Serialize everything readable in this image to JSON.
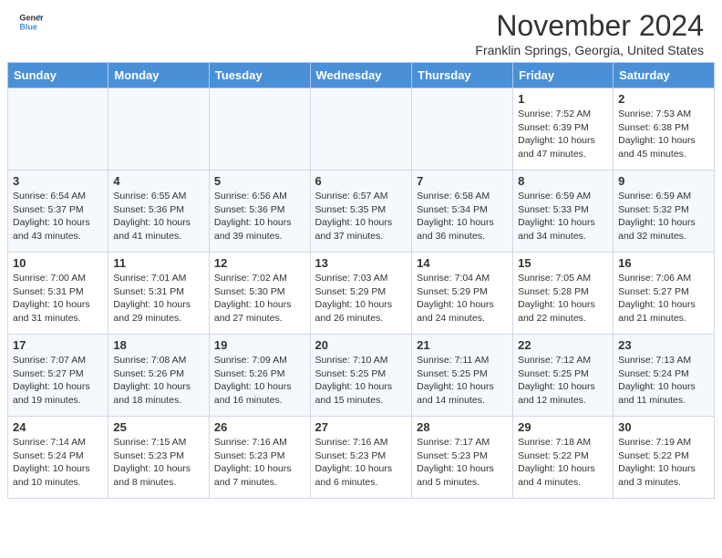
{
  "header": {
    "logo_line1": "General",
    "logo_line2": "Blue",
    "main_title": "November 2024",
    "subtitle": "Franklin Springs, Georgia, United States"
  },
  "calendar": {
    "days_of_week": [
      "Sunday",
      "Monday",
      "Tuesday",
      "Wednesday",
      "Thursday",
      "Friday",
      "Saturday"
    ],
    "weeks": [
      [
        {
          "day": "",
          "info": ""
        },
        {
          "day": "",
          "info": ""
        },
        {
          "day": "",
          "info": ""
        },
        {
          "day": "",
          "info": ""
        },
        {
          "day": "",
          "info": ""
        },
        {
          "day": "1",
          "info": "Sunrise: 7:52 AM\nSunset: 6:39 PM\nDaylight: 10 hours and 47 minutes."
        },
        {
          "day": "2",
          "info": "Sunrise: 7:53 AM\nSunset: 6:38 PM\nDaylight: 10 hours and 45 minutes."
        }
      ],
      [
        {
          "day": "3",
          "info": "Sunrise: 6:54 AM\nSunset: 5:37 PM\nDaylight: 10 hours and 43 minutes."
        },
        {
          "day": "4",
          "info": "Sunrise: 6:55 AM\nSunset: 5:36 PM\nDaylight: 10 hours and 41 minutes."
        },
        {
          "day": "5",
          "info": "Sunrise: 6:56 AM\nSunset: 5:36 PM\nDaylight: 10 hours and 39 minutes."
        },
        {
          "day": "6",
          "info": "Sunrise: 6:57 AM\nSunset: 5:35 PM\nDaylight: 10 hours and 37 minutes."
        },
        {
          "day": "7",
          "info": "Sunrise: 6:58 AM\nSunset: 5:34 PM\nDaylight: 10 hours and 36 minutes."
        },
        {
          "day": "8",
          "info": "Sunrise: 6:59 AM\nSunset: 5:33 PM\nDaylight: 10 hours and 34 minutes."
        },
        {
          "day": "9",
          "info": "Sunrise: 6:59 AM\nSunset: 5:32 PM\nDaylight: 10 hours and 32 minutes."
        }
      ],
      [
        {
          "day": "10",
          "info": "Sunrise: 7:00 AM\nSunset: 5:31 PM\nDaylight: 10 hours and 31 minutes."
        },
        {
          "day": "11",
          "info": "Sunrise: 7:01 AM\nSunset: 5:31 PM\nDaylight: 10 hours and 29 minutes."
        },
        {
          "day": "12",
          "info": "Sunrise: 7:02 AM\nSunset: 5:30 PM\nDaylight: 10 hours and 27 minutes."
        },
        {
          "day": "13",
          "info": "Sunrise: 7:03 AM\nSunset: 5:29 PM\nDaylight: 10 hours and 26 minutes."
        },
        {
          "day": "14",
          "info": "Sunrise: 7:04 AM\nSunset: 5:29 PM\nDaylight: 10 hours and 24 minutes."
        },
        {
          "day": "15",
          "info": "Sunrise: 7:05 AM\nSunset: 5:28 PM\nDaylight: 10 hours and 22 minutes."
        },
        {
          "day": "16",
          "info": "Sunrise: 7:06 AM\nSunset: 5:27 PM\nDaylight: 10 hours and 21 minutes."
        }
      ],
      [
        {
          "day": "17",
          "info": "Sunrise: 7:07 AM\nSunset: 5:27 PM\nDaylight: 10 hours and 19 minutes."
        },
        {
          "day": "18",
          "info": "Sunrise: 7:08 AM\nSunset: 5:26 PM\nDaylight: 10 hours and 18 minutes."
        },
        {
          "day": "19",
          "info": "Sunrise: 7:09 AM\nSunset: 5:26 PM\nDaylight: 10 hours and 16 minutes."
        },
        {
          "day": "20",
          "info": "Sunrise: 7:10 AM\nSunset: 5:25 PM\nDaylight: 10 hours and 15 minutes."
        },
        {
          "day": "21",
          "info": "Sunrise: 7:11 AM\nSunset: 5:25 PM\nDaylight: 10 hours and 14 minutes."
        },
        {
          "day": "22",
          "info": "Sunrise: 7:12 AM\nSunset: 5:25 PM\nDaylight: 10 hours and 12 minutes."
        },
        {
          "day": "23",
          "info": "Sunrise: 7:13 AM\nSunset: 5:24 PM\nDaylight: 10 hours and 11 minutes."
        }
      ],
      [
        {
          "day": "24",
          "info": "Sunrise: 7:14 AM\nSunset: 5:24 PM\nDaylight: 10 hours and 10 minutes."
        },
        {
          "day": "25",
          "info": "Sunrise: 7:15 AM\nSunset: 5:23 PM\nDaylight: 10 hours and 8 minutes."
        },
        {
          "day": "26",
          "info": "Sunrise: 7:16 AM\nSunset: 5:23 PM\nDaylight: 10 hours and 7 minutes."
        },
        {
          "day": "27",
          "info": "Sunrise: 7:16 AM\nSunset: 5:23 PM\nDaylight: 10 hours and 6 minutes."
        },
        {
          "day": "28",
          "info": "Sunrise: 7:17 AM\nSunset: 5:23 PM\nDaylight: 10 hours and 5 minutes."
        },
        {
          "day": "29",
          "info": "Sunrise: 7:18 AM\nSunset: 5:22 PM\nDaylight: 10 hours and 4 minutes."
        },
        {
          "day": "30",
          "info": "Sunrise: 7:19 AM\nSunset: 5:22 PM\nDaylight: 10 hours and 3 minutes."
        }
      ]
    ]
  }
}
